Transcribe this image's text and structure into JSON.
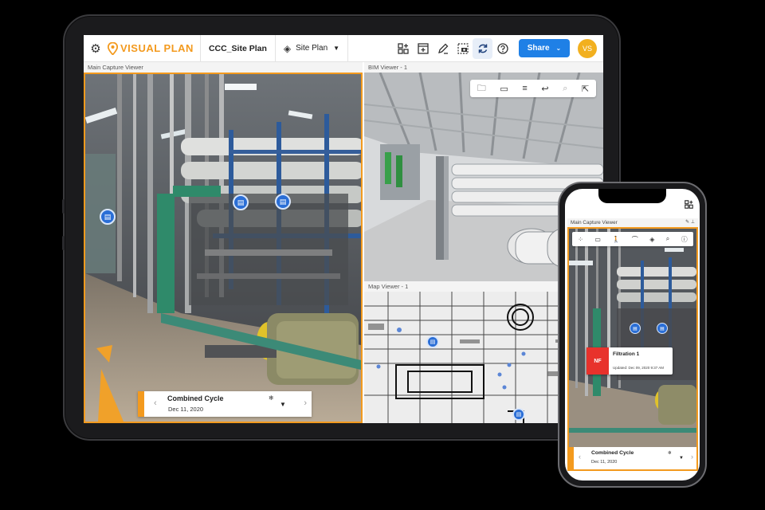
{
  "app": {
    "brand": "VISUAL PLAN",
    "project": "CCC_Site Plan",
    "plan_selector": "Site Plan",
    "share_label": "Share",
    "avatar_initials": "VS"
  },
  "panels": {
    "main_capture": "Main Capture Viewer",
    "bim": "BIM Viewer - 1",
    "map": "Map Viewer - 1"
  },
  "timeline": {
    "title": "Combined Cycle",
    "date": "Dec 11, 2020"
  },
  "phone": {
    "panel_label": "Main Capture Viewer",
    "card_badge": "NF",
    "card_title": "Filtration 1",
    "card_updated": "Updated: Dec 09, 2020 9:37 AM",
    "timeline_title": "Combined Cycle",
    "timeline_date": "Dec 11, 2020"
  },
  "colors": {
    "brand_orange": "#f39a1e",
    "share_blue": "#1f80e6",
    "marker_blue": "#2a6ed6",
    "nf_red": "#e8322c",
    "avatar_yellow": "#f2b01f"
  },
  "icons": {
    "toolbar": [
      "add-widget-icon",
      "new-window-icon",
      "edit-icon",
      "screenshot-icon",
      "sync-icon",
      "help-icon"
    ],
    "bim_toolbar": [
      "folder-icon",
      "ruler-icon",
      "sliders-icon",
      "undo-icon",
      "zoom-icon",
      "external-link-icon"
    ]
  }
}
